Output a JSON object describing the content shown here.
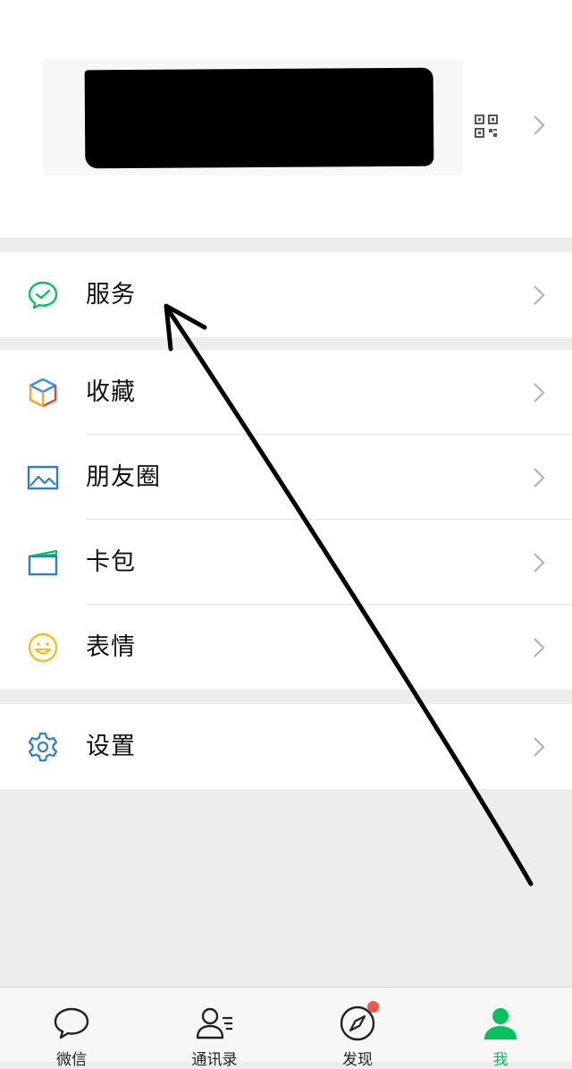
{
  "menu": {
    "services": "服务",
    "favorites": "收藏",
    "moments": "朋友圈",
    "cards": "卡包",
    "stickers": "表情",
    "settings": "设置"
  },
  "tabs": {
    "chats": "微信",
    "contacts": "通讯录",
    "discover": "发现",
    "me": "我"
  },
  "colors": {
    "accent": "#07c160",
    "badge": "#fa5151",
    "settings_icon": "#2f7cd3"
  }
}
